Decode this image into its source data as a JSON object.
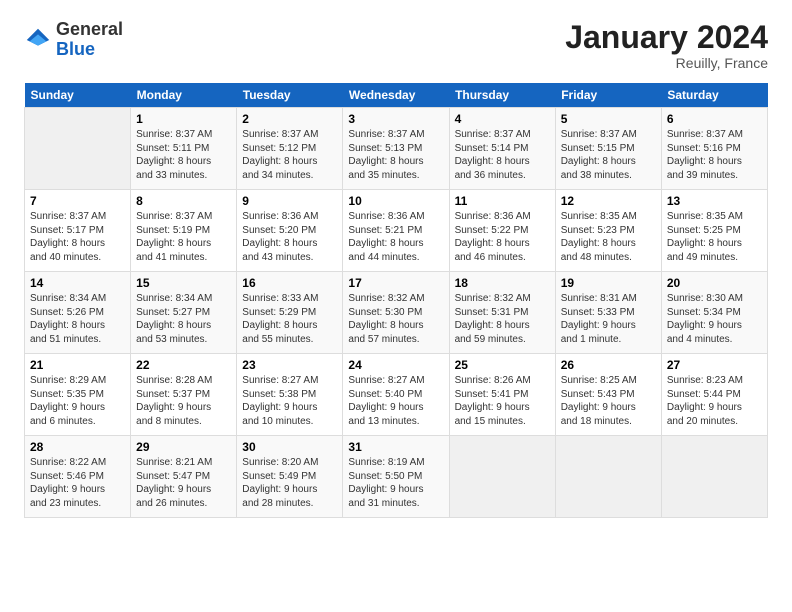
{
  "header": {
    "logo_general": "General",
    "logo_blue": "Blue",
    "month_title": "January 2024",
    "location": "Reuilly, France"
  },
  "days_of_week": [
    "Sunday",
    "Monday",
    "Tuesday",
    "Wednesday",
    "Thursday",
    "Friday",
    "Saturday"
  ],
  "weeks": [
    [
      {
        "day": "",
        "detail": ""
      },
      {
        "day": "1",
        "detail": "Sunrise: 8:37 AM\nSunset: 5:11 PM\nDaylight: 8 hours\nand 33 minutes."
      },
      {
        "day": "2",
        "detail": "Sunrise: 8:37 AM\nSunset: 5:12 PM\nDaylight: 8 hours\nand 34 minutes."
      },
      {
        "day": "3",
        "detail": "Sunrise: 8:37 AM\nSunset: 5:13 PM\nDaylight: 8 hours\nand 35 minutes."
      },
      {
        "day": "4",
        "detail": "Sunrise: 8:37 AM\nSunset: 5:14 PM\nDaylight: 8 hours\nand 36 minutes."
      },
      {
        "day": "5",
        "detail": "Sunrise: 8:37 AM\nSunset: 5:15 PM\nDaylight: 8 hours\nand 38 minutes."
      },
      {
        "day": "6",
        "detail": "Sunrise: 8:37 AM\nSunset: 5:16 PM\nDaylight: 8 hours\nand 39 minutes."
      }
    ],
    [
      {
        "day": "7",
        "detail": "Sunrise: 8:37 AM\nSunset: 5:17 PM\nDaylight: 8 hours\nand 40 minutes."
      },
      {
        "day": "8",
        "detail": "Sunrise: 8:37 AM\nSunset: 5:19 PM\nDaylight: 8 hours\nand 41 minutes."
      },
      {
        "day": "9",
        "detail": "Sunrise: 8:36 AM\nSunset: 5:20 PM\nDaylight: 8 hours\nand 43 minutes."
      },
      {
        "day": "10",
        "detail": "Sunrise: 8:36 AM\nSunset: 5:21 PM\nDaylight: 8 hours\nand 44 minutes."
      },
      {
        "day": "11",
        "detail": "Sunrise: 8:36 AM\nSunset: 5:22 PM\nDaylight: 8 hours\nand 46 minutes."
      },
      {
        "day": "12",
        "detail": "Sunrise: 8:35 AM\nSunset: 5:23 PM\nDaylight: 8 hours\nand 48 minutes."
      },
      {
        "day": "13",
        "detail": "Sunrise: 8:35 AM\nSunset: 5:25 PM\nDaylight: 8 hours\nand 49 minutes."
      }
    ],
    [
      {
        "day": "14",
        "detail": "Sunrise: 8:34 AM\nSunset: 5:26 PM\nDaylight: 8 hours\nand 51 minutes."
      },
      {
        "day": "15",
        "detail": "Sunrise: 8:34 AM\nSunset: 5:27 PM\nDaylight: 8 hours\nand 53 minutes."
      },
      {
        "day": "16",
        "detail": "Sunrise: 8:33 AM\nSunset: 5:29 PM\nDaylight: 8 hours\nand 55 minutes."
      },
      {
        "day": "17",
        "detail": "Sunrise: 8:32 AM\nSunset: 5:30 PM\nDaylight: 8 hours\nand 57 minutes."
      },
      {
        "day": "18",
        "detail": "Sunrise: 8:32 AM\nSunset: 5:31 PM\nDaylight: 8 hours\nand 59 minutes."
      },
      {
        "day": "19",
        "detail": "Sunrise: 8:31 AM\nSunset: 5:33 PM\nDaylight: 9 hours\nand 1 minute."
      },
      {
        "day": "20",
        "detail": "Sunrise: 8:30 AM\nSunset: 5:34 PM\nDaylight: 9 hours\nand 4 minutes."
      }
    ],
    [
      {
        "day": "21",
        "detail": "Sunrise: 8:29 AM\nSunset: 5:35 PM\nDaylight: 9 hours\nand 6 minutes."
      },
      {
        "day": "22",
        "detail": "Sunrise: 8:28 AM\nSunset: 5:37 PM\nDaylight: 9 hours\nand 8 minutes."
      },
      {
        "day": "23",
        "detail": "Sunrise: 8:27 AM\nSunset: 5:38 PM\nDaylight: 9 hours\nand 10 minutes."
      },
      {
        "day": "24",
        "detail": "Sunrise: 8:27 AM\nSunset: 5:40 PM\nDaylight: 9 hours\nand 13 minutes."
      },
      {
        "day": "25",
        "detail": "Sunrise: 8:26 AM\nSunset: 5:41 PM\nDaylight: 9 hours\nand 15 minutes."
      },
      {
        "day": "26",
        "detail": "Sunrise: 8:25 AM\nSunset: 5:43 PM\nDaylight: 9 hours\nand 18 minutes."
      },
      {
        "day": "27",
        "detail": "Sunrise: 8:23 AM\nSunset: 5:44 PM\nDaylight: 9 hours\nand 20 minutes."
      }
    ],
    [
      {
        "day": "28",
        "detail": "Sunrise: 8:22 AM\nSunset: 5:46 PM\nDaylight: 9 hours\nand 23 minutes."
      },
      {
        "day": "29",
        "detail": "Sunrise: 8:21 AM\nSunset: 5:47 PM\nDaylight: 9 hours\nand 26 minutes."
      },
      {
        "day": "30",
        "detail": "Sunrise: 8:20 AM\nSunset: 5:49 PM\nDaylight: 9 hours\nand 28 minutes."
      },
      {
        "day": "31",
        "detail": "Sunrise: 8:19 AM\nSunset: 5:50 PM\nDaylight: 9 hours\nand 31 minutes."
      },
      {
        "day": "",
        "detail": ""
      },
      {
        "day": "",
        "detail": ""
      },
      {
        "day": "",
        "detail": ""
      }
    ]
  ]
}
